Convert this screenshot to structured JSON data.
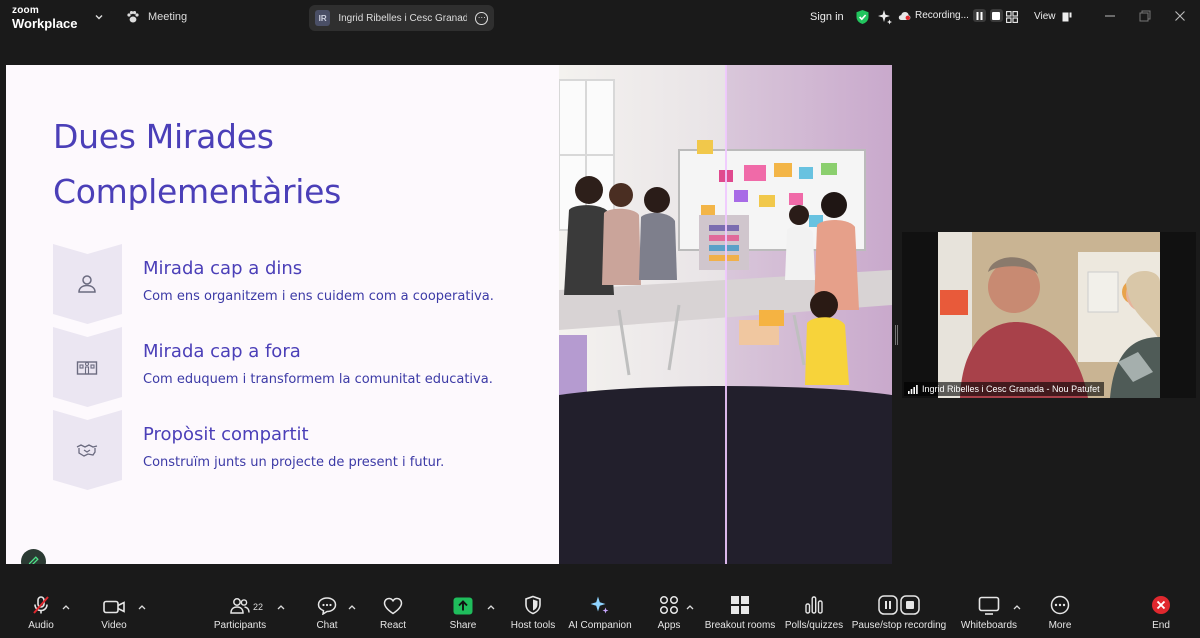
{
  "app": {
    "brand_small": "zoom",
    "brand_large": "Workplace",
    "meeting_label": "Meeting",
    "speaker_pill": {
      "initials": "IR",
      "name": "Ingrid Ribelles i Cesc Granada - Nou Patufet"
    },
    "sign_in": "Sign in",
    "recording_label": "Recording...",
    "view_label": "View"
  },
  "slide": {
    "title_line1": "Dues Mirades",
    "title_line2": "Complementàries",
    "items": [
      {
        "heading": "Mirada cap a dins",
        "desc": "Com ens organitzem i ens cuidem com a cooperativa.",
        "icon": "person-icon"
      },
      {
        "heading": "Mirada cap a fora",
        "desc": "Com eduquem i transformem la comunitat educativa.",
        "icon": "school-icon"
      },
      {
        "heading": "Propòsit compartit",
        "desc": "Construïm junts un projecte de present i futur.",
        "icon": "handshake-icon"
      }
    ]
  },
  "video_tile": {
    "participant_name": "Ingrid Ribelles i Cesc Granada - Nou Patufet"
  },
  "toolbar": {
    "audio": "Audio",
    "video": "Video",
    "participants": "Participants",
    "participants_count": "22",
    "chat": "Chat",
    "react": "React",
    "share": "Share",
    "host_tools": "Host tools",
    "ai_companion": "AI Companion",
    "apps": "Apps",
    "breakout_rooms": "Breakout rooms",
    "polls": "Polls/quizzes",
    "pause_recording": "Pause/stop recording",
    "whiteboards": "Whiteboards",
    "more": "More",
    "end": "End"
  },
  "colors": {
    "slide_accent": "#4b3fb8",
    "share_green": "#1fbd5c",
    "end_red": "#e0282e",
    "shield_green": "#22c55e"
  }
}
